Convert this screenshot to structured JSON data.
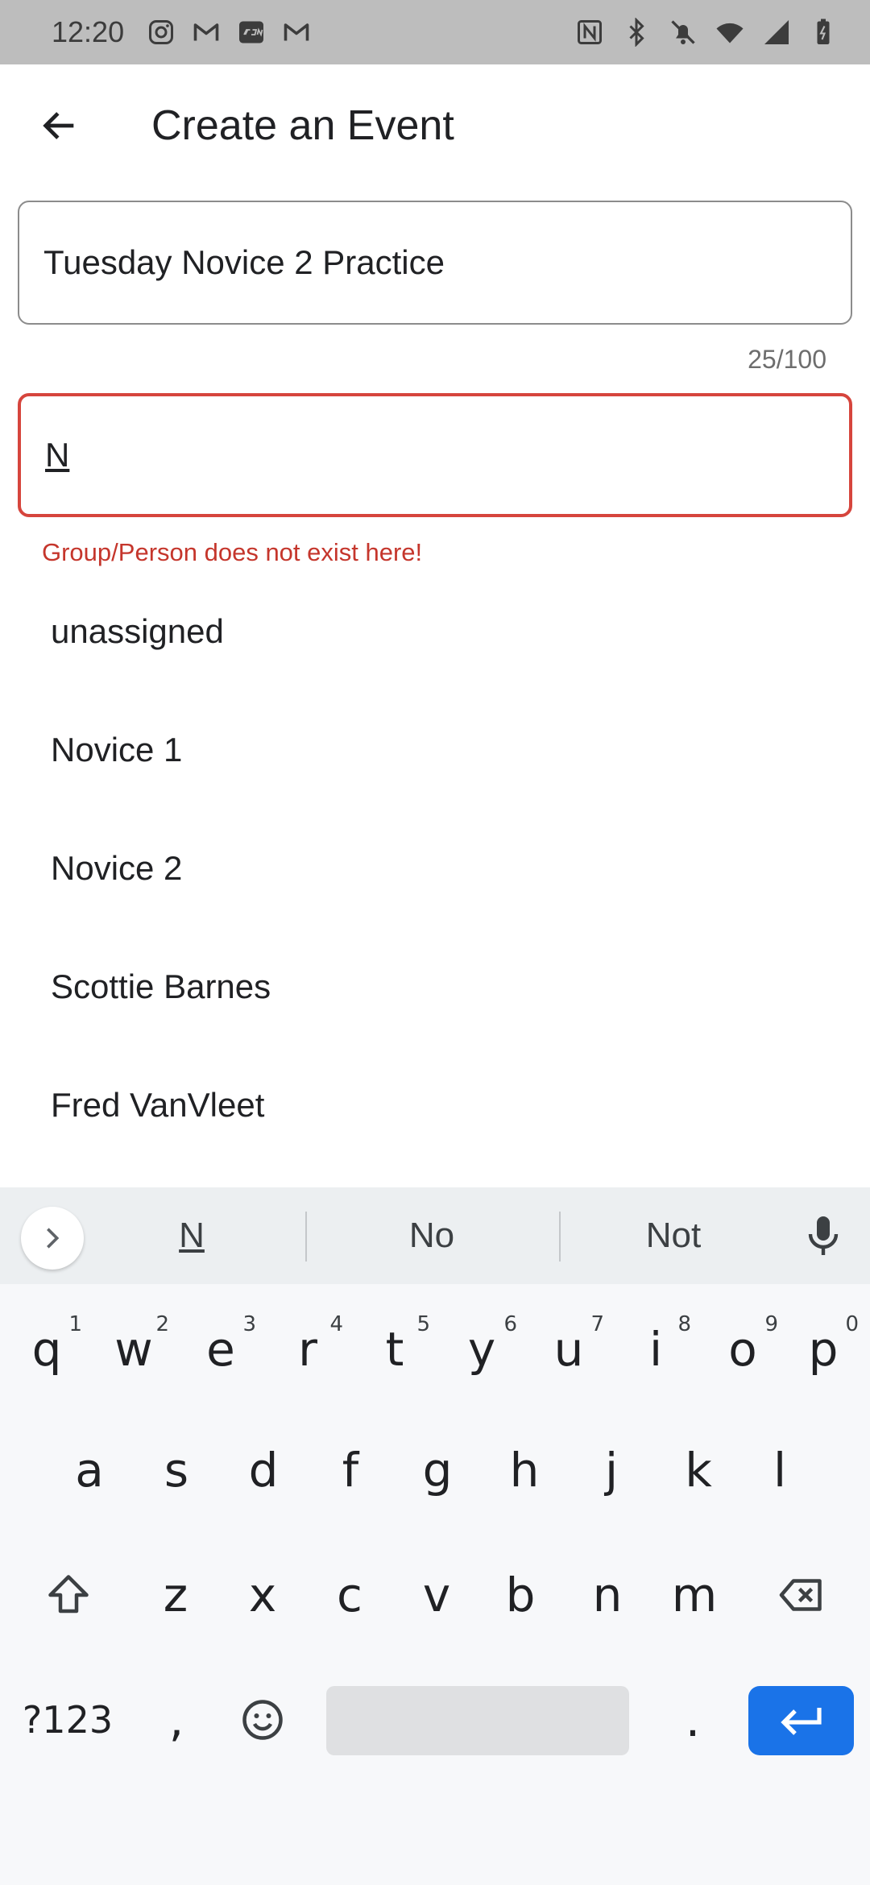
{
  "status_bar": {
    "time": "12:20",
    "left_icons": [
      "instagram-icon",
      "gmail-icon",
      "tsn-icon",
      "gmail-icon"
    ],
    "right_icons": [
      "nfc-icon",
      "bluetooth-icon",
      "bell-off-icon",
      "wifi-icon",
      "signal-icon",
      "battery-icon"
    ]
  },
  "app_bar": {
    "back_icon": "arrow-left-icon",
    "title": "Create an Event"
  },
  "form": {
    "event_name": {
      "value": "Tuesday Novice 2 Practice",
      "counter": "25/100"
    },
    "group_field": {
      "value": "N",
      "error": "Group/Person does not exist here!",
      "error_color": "#c5362c"
    }
  },
  "suggestions": [
    {
      "label": "unassigned"
    },
    {
      "label": "Novice 1"
    },
    {
      "label": "Novice 2"
    },
    {
      "label": "Scottie Barnes"
    },
    {
      "label": "Fred VanVleet"
    }
  ],
  "keyboard": {
    "strip_words": [
      "N",
      "No",
      "Not"
    ],
    "row1": [
      {
        "key": "q",
        "hint": "1"
      },
      {
        "key": "w",
        "hint": "2"
      },
      {
        "key": "e",
        "hint": "3"
      },
      {
        "key": "r",
        "hint": "4"
      },
      {
        "key": "t",
        "hint": "5"
      },
      {
        "key": "y",
        "hint": "6"
      },
      {
        "key": "u",
        "hint": "7"
      },
      {
        "key": "i",
        "hint": "8"
      },
      {
        "key": "o",
        "hint": "9"
      },
      {
        "key": "p",
        "hint": "0"
      }
    ],
    "row2": [
      "a",
      "s",
      "d",
      "f",
      "g",
      "h",
      "j",
      "k",
      "l"
    ],
    "row3": [
      "z",
      "x",
      "c",
      "v",
      "b",
      "n",
      "m"
    ],
    "symbols_label": "?123",
    "comma": ",",
    "period": ".",
    "accent_color": "#1a73e8"
  }
}
